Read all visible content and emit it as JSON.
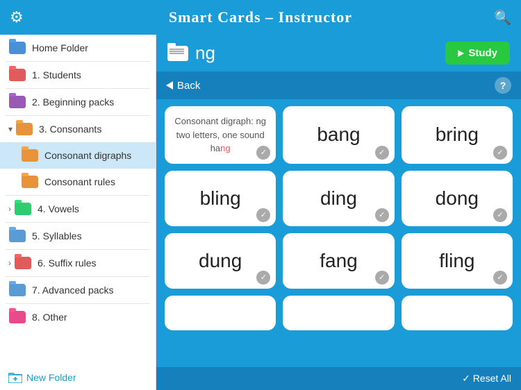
{
  "header": {
    "title": "Smart Cards – Instructor",
    "gear_icon": "⚙",
    "search_icon": "🔍"
  },
  "sidebar": {
    "items": [
      {
        "id": "home-folder",
        "label": "Home Folder",
        "color": "f-blue",
        "indent": 0,
        "expandable": false
      },
      {
        "id": "students",
        "label": "1. Students",
        "color": "f-red",
        "indent": 0,
        "expandable": false
      },
      {
        "id": "beginning-packs",
        "label": "2. Beginning packs",
        "color": "f-purple",
        "indent": 0,
        "expandable": false
      },
      {
        "id": "consonants",
        "label": "3. Consonants",
        "color": "f-orange",
        "indent": 0,
        "expandable": true,
        "expanded": true
      },
      {
        "id": "consonant-digraphs",
        "label": "Consonant digraphs",
        "color": "f-orange",
        "indent": 1,
        "active": true
      },
      {
        "id": "consonant-rules",
        "label": "Consonant rules",
        "color": "f-orange",
        "indent": 1
      },
      {
        "id": "vowels",
        "label": "4. Vowels",
        "color": "f-green",
        "indent": 0,
        "expandable": true,
        "expanded": false
      },
      {
        "id": "syllables",
        "label": "5. Syllables",
        "color": "f-blue2",
        "indent": 0,
        "expandable": false
      },
      {
        "id": "suffix-rules",
        "label": "6. Suffix rules",
        "color": "f-red",
        "indent": 0,
        "expandable": true,
        "expanded": false
      },
      {
        "id": "advanced-packs",
        "label": "7. Advanced packs",
        "color": "f-blue2",
        "indent": 0,
        "expandable": false
      },
      {
        "id": "other",
        "label": "8. Other",
        "color": "f-pink",
        "indent": 0,
        "expandable": false
      }
    ],
    "new_folder_label": "New Folder"
  },
  "content": {
    "folder_title": "ng",
    "study_button": "Study",
    "back_label": "Back",
    "reset_all_label": "✓ Reset All",
    "cards": [
      {
        "id": "card-def",
        "type": "definition",
        "line1": "Consonant digraph: ng",
        "line2": "two letters, one sound",
        "line3": "ha",
        "highlight": "ng",
        "checked": true
      },
      {
        "id": "card-bang",
        "type": "word",
        "word": "bang",
        "checked": true
      },
      {
        "id": "card-bring",
        "type": "word",
        "word": "bring",
        "checked": true
      },
      {
        "id": "card-bling",
        "type": "word",
        "word": "bling",
        "checked": true
      },
      {
        "id": "card-ding",
        "type": "word",
        "word": "ding",
        "checked": true
      },
      {
        "id": "card-dong",
        "type": "word",
        "word": "dong",
        "checked": true
      },
      {
        "id": "card-dung",
        "type": "word",
        "word": "dung",
        "checked": true
      },
      {
        "id": "card-fang",
        "type": "word",
        "word": "fang",
        "checked": true
      },
      {
        "id": "card-fling",
        "type": "word",
        "word": "fling",
        "checked": true
      },
      {
        "id": "card-partial1",
        "type": "word",
        "word": "",
        "checked": false,
        "partial": true
      },
      {
        "id": "card-partial2",
        "type": "word",
        "word": "",
        "checked": false,
        "partial": true
      },
      {
        "id": "card-partial3",
        "type": "word",
        "word": "",
        "checked": false,
        "partial": true
      }
    ]
  }
}
